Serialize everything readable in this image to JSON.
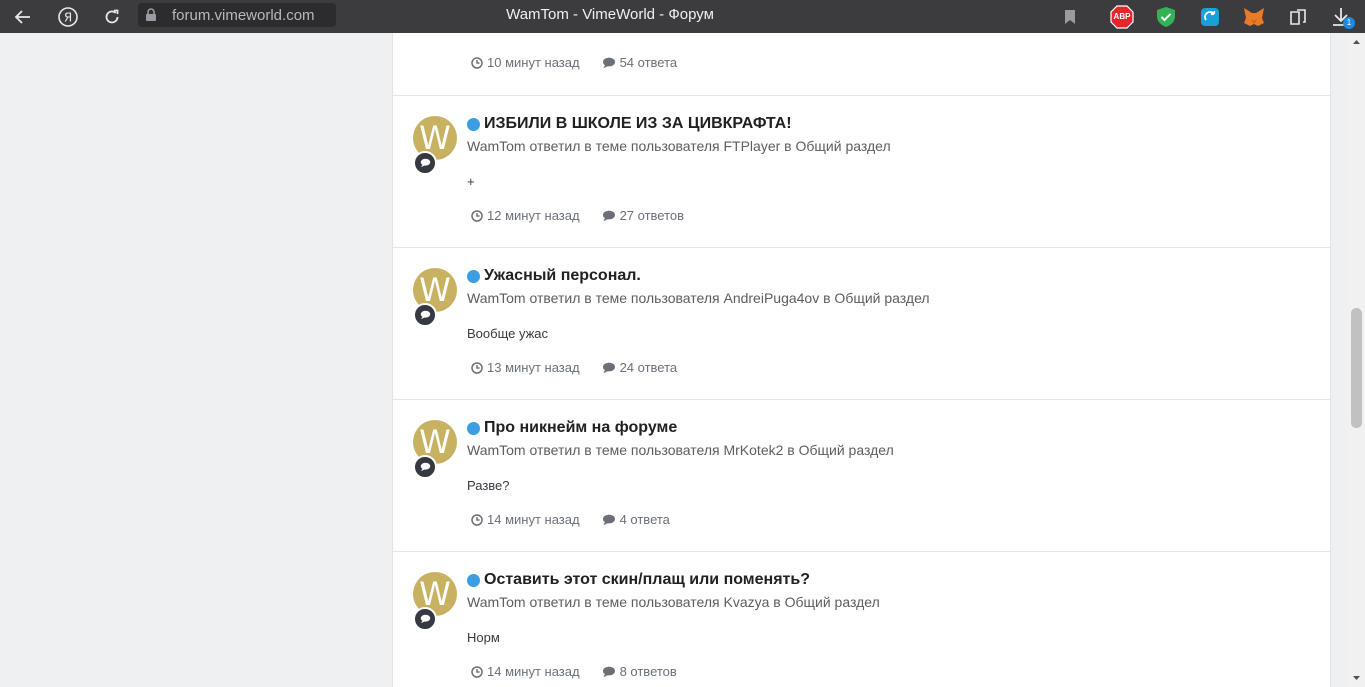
{
  "browser": {
    "url": "forum.vimeworld.com",
    "tab_title": "WamTom - VimeWorld - Форум",
    "downloads_badge": "1",
    "abp_label": "ABP"
  },
  "items": [
    {
      "title": "",
      "meta": "",
      "snippet": "",
      "time": "10 минут назад",
      "replies": "54 ответа"
    },
    {
      "avatar_letter": "W",
      "title": "ИЗБИЛИ В ШКОЛЕ ИЗ ЗА ЦИВКРАФТА!",
      "meta": "WamTom ответил в теме пользователя FTPlayer в Общий раздел",
      "snippet": "+",
      "time": "12 минут назад",
      "replies": "27 ответов"
    },
    {
      "avatar_letter": "W",
      "title": "Ужасный персонал.",
      "meta": "WamTom ответил в теме пользователя AndreiPuga4ov в Общий раздел",
      "snippet": "Вообще ужас",
      "time": "13 минут назад",
      "replies": "24 ответа"
    },
    {
      "avatar_letter": "W",
      "title": "Про никнейм на форуме",
      "meta": "WamTom ответил в теме пользователя MrKotek2 в Общий раздел",
      "snippet": "Разве?",
      "time": "14 минут назад",
      "replies": "4 ответа"
    },
    {
      "avatar_letter": "W",
      "title": "Оставить этот скин/плащ или поменять?",
      "meta": "WamTom ответил в теме пользователя Kvazya в Общий раздел",
      "snippet": "Норм",
      "time": "14 минут назад",
      "replies": "8 ответов"
    }
  ],
  "colors": {
    "avatar_bg": "#c8b160",
    "unread_dot": "#3b9ee2",
    "topbar_bg": "#3c3c3f"
  },
  "icons": {
    "time": "clock-icon",
    "replies": "comment-icon",
    "badge": "comment-badge-icon"
  }
}
